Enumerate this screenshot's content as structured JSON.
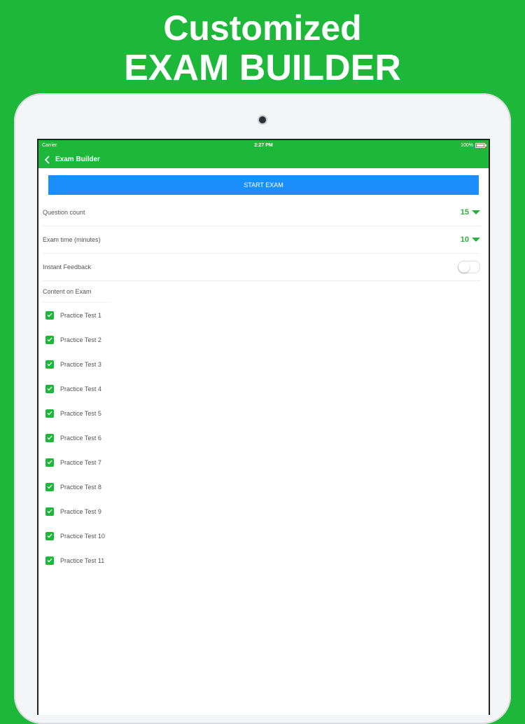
{
  "headline": {
    "line1": "Customized",
    "line2": "EXAM BUILDER"
  },
  "status_bar": {
    "carrier": "Carrier",
    "time": "2:27 PM",
    "battery": "100%"
  },
  "nav": {
    "title": "Exam Builder",
    "back_icon": "chevron-left-icon"
  },
  "start_button": {
    "label": "START EXAM",
    "color": "#1a8ffb"
  },
  "settings": {
    "question_count": {
      "label": "Question count",
      "value": "15"
    },
    "exam_time": {
      "label": "Exam time (minutes)",
      "value": "10"
    },
    "instant_feedback": {
      "label": "Instant Feedback",
      "enabled": false
    }
  },
  "content_section": {
    "label": "Content on Exam",
    "items": [
      {
        "label": "Practice Test 1",
        "checked": true
      },
      {
        "label": "Practice Test 2",
        "checked": true
      },
      {
        "label": "Practice Test 3",
        "checked": true
      },
      {
        "label": "Practice Test 4",
        "checked": true
      },
      {
        "label": "Practice Test 5",
        "checked": true
      },
      {
        "label": "Practice Test 6",
        "checked": true
      },
      {
        "label": "Practice Test 7",
        "checked": true
      },
      {
        "label": "Practice Test 8",
        "checked": true
      },
      {
        "label": "Practice Test 9",
        "checked": true
      },
      {
        "label": "Practice Test 10",
        "checked": true
      },
      {
        "label": "Practice Test 11",
        "checked": true
      }
    ]
  },
  "colors": {
    "brand_green": "#1db739",
    "accent_green": "#2fae40",
    "button_blue": "#1a8ffb"
  }
}
